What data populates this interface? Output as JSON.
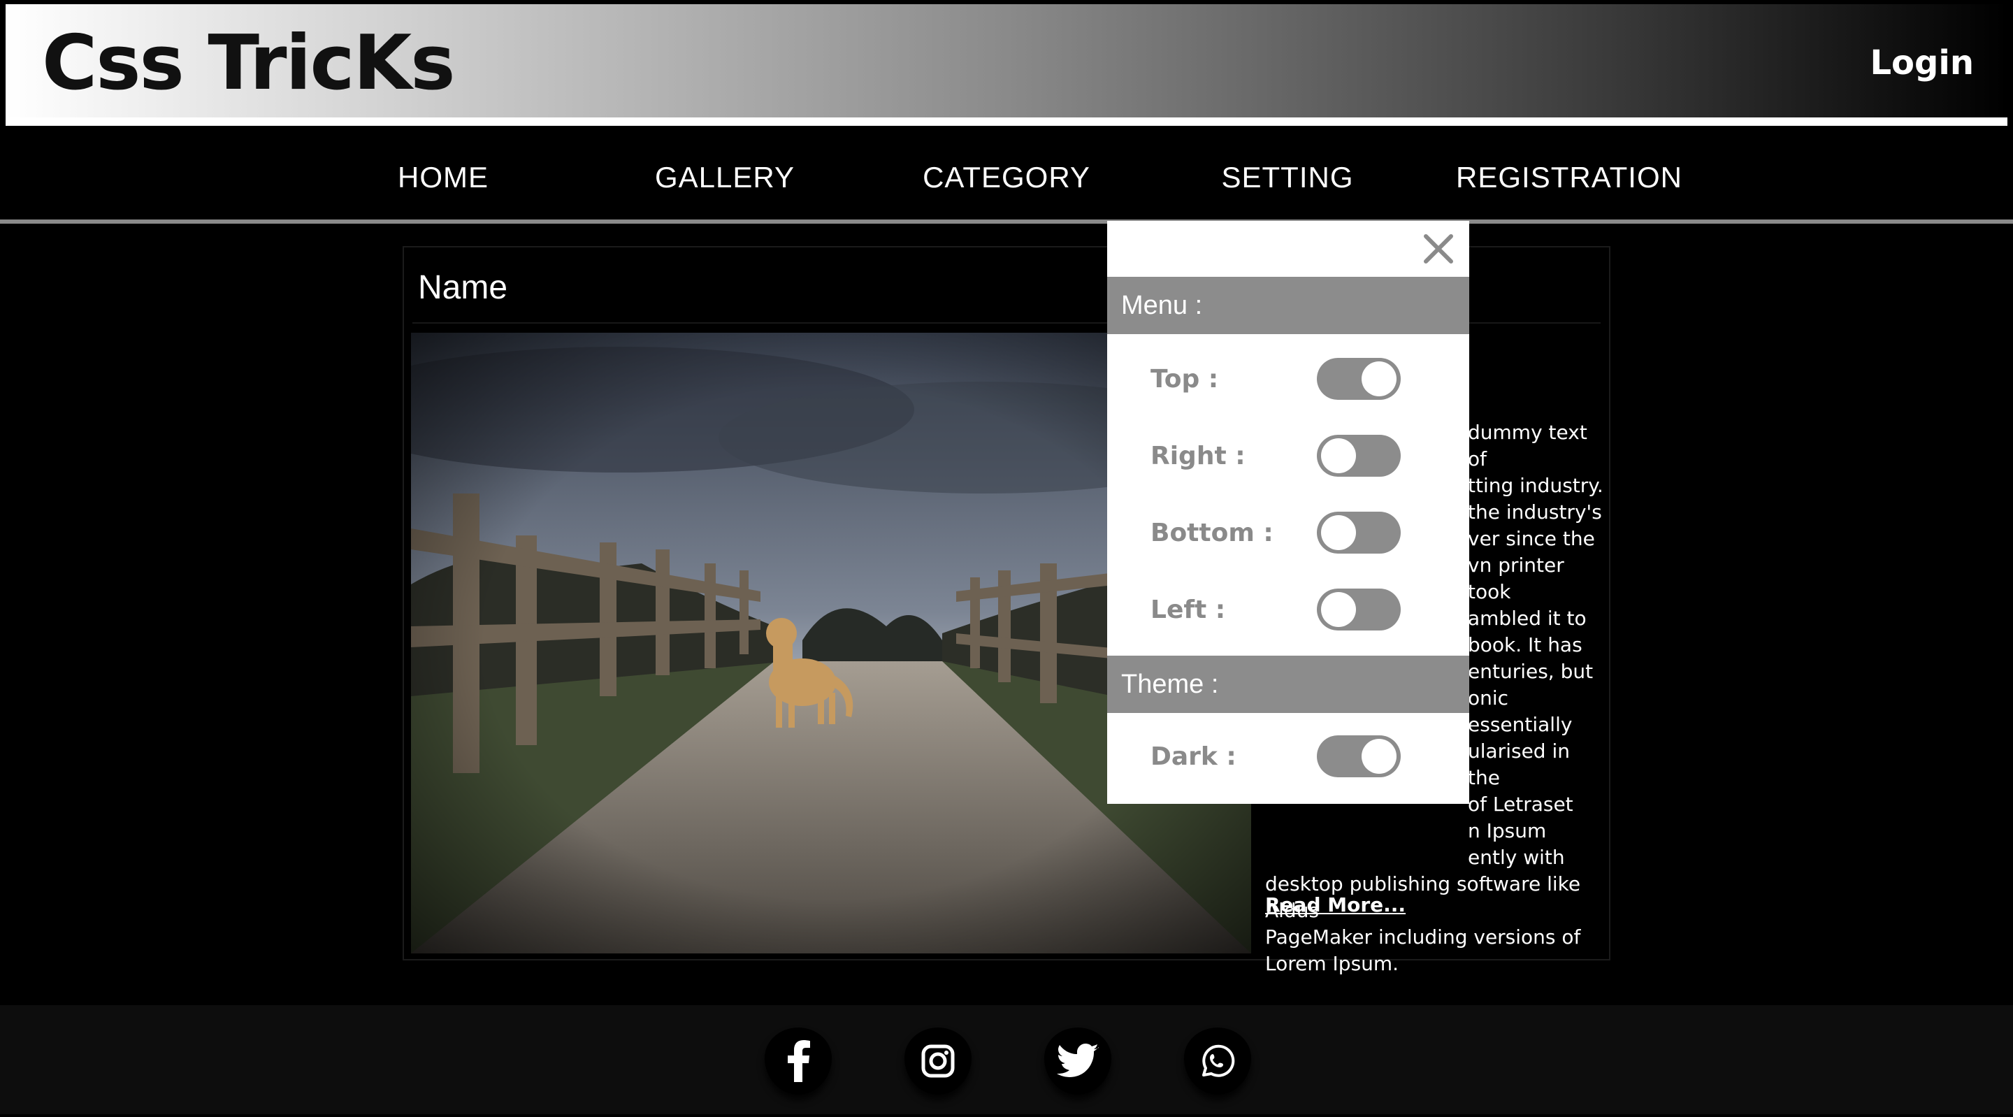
{
  "header": {
    "logo": "Css TricKs",
    "login_label": "Login"
  },
  "nav": {
    "items": [
      {
        "label": "HOME"
      },
      {
        "label": "GALLERY"
      },
      {
        "label": "CATEGORY"
      },
      {
        "label": "SETTING"
      },
      {
        "label": "REGISTRATION"
      }
    ]
  },
  "card": {
    "title": "Name",
    "description_lines": [
      "dummy text of",
      "tting industry.",
      "the industry's",
      "ver since the",
      "vn printer took",
      "ambled it to",
      "book. It has",
      "enturies, but",
      "onic",
      "essentially",
      "ularised in the",
      "of Letraset",
      "n Ipsum",
      "ently with",
      "desktop publishing software like Aldus",
      "PageMaker including versions of",
      "Lorem Ipsum."
    ],
    "read_more": "Read More..."
  },
  "settings_panel": {
    "menu_heading": "Menu :",
    "theme_heading": "Theme :",
    "options": [
      {
        "label": "Top :",
        "on": true
      },
      {
        "label": "Right :",
        "on": false
      },
      {
        "label": "Bottom :",
        "on": false
      },
      {
        "label": "Left :",
        "on": false
      }
    ],
    "dark": {
      "label": "Dark :",
      "on": true
    }
  },
  "footer": {
    "social": [
      "facebook-icon",
      "instagram-icon",
      "twitter-icon",
      "whatsapp-icon"
    ]
  },
  "colors": {
    "panel_heading": "#8c8c8c",
    "toggle": "#8c8c8c",
    "label": "#8a8a8a"
  }
}
